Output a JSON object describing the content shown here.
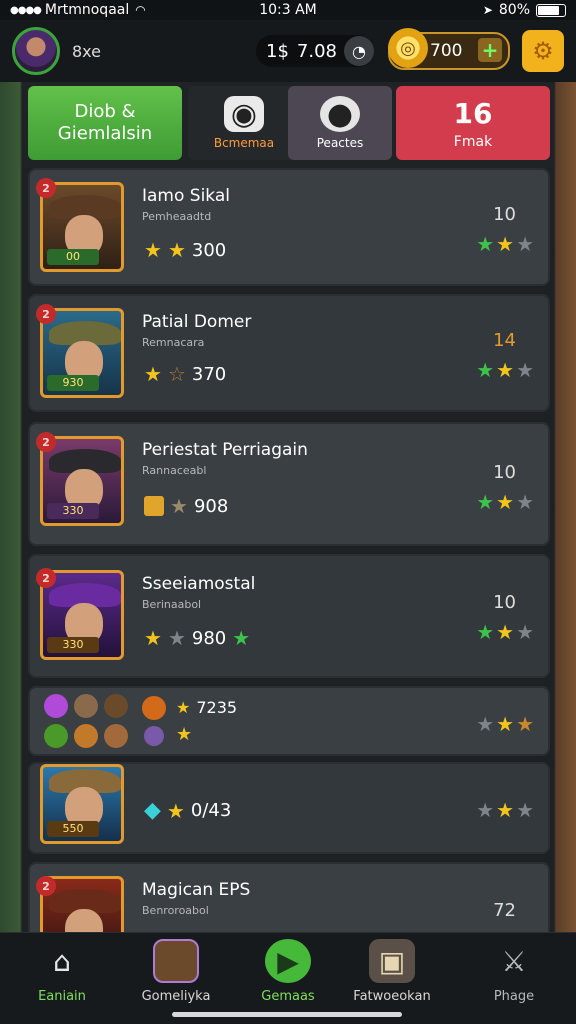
{
  "status_bar": {
    "carrier": "Mrtmnoqaal",
    "time": "10:3 AM",
    "battery": "80%"
  },
  "header": {
    "username": "8xe",
    "timer_value": "7.08",
    "timer_prefix": "1$",
    "coins": "700",
    "colors": {
      "accent_gold": "#f2b21c",
      "green": "#4fae40",
      "red": "#d33c4c"
    }
  },
  "tabs": [
    {
      "label": "Diob &\nGiemlalsin",
      "active": true
    },
    {
      "label": "Bcmemaa",
      "icon": "robot-icon"
    },
    {
      "label": "Peactes",
      "icon": "dog-icon"
    },
    {
      "value": "16",
      "label": "Fmak"
    }
  ],
  "cards": [
    {
      "badge": "2",
      "name": "Iamo Sikal",
      "subtitle": "Pemheaadtd",
      "score": "300",
      "level": "00",
      "rank": "10"
    },
    {
      "badge": "2",
      "name": "Patial Domer",
      "subtitle": "Remnacara",
      "score": "370",
      "level": "930",
      "rank": "14"
    },
    {
      "badge": "2",
      "name": "Periestat Perriagain",
      "subtitle": "Rannaceabl",
      "score": "908",
      "level": "330",
      "rank": "10"
    },
    {
      "badge": "2",
      "name": "Sseeiamostal",
      "subtitle": "Berinaabol",
      "score": "980",
      "level": "330",
      "rank": "10"
    },
    {
      "score": "7235"
    },
    {
      "score": "0/43",
      "level": "550"
    },
    {
      "badge": "2",
      "name": "Magican EPS",
      "subtitle": "Benroroabol",
      "rank": "72"
    }
  ],
  "nav": [
    {
      "label": "Eaniain",
      "icon": "home-icon"
    },
    {
      "label": "Gomeliyka",
      "icon": "hero-icon"
    },
    {
      "label": "Gemaas",
      "icon": "play-icon"
    },
    {
      "label": "Fatwoeokan",
      "icon": "chest-icon"
    },
    {
      "label": "Phage",
      "icon": "sword-icon"
    }
  ]
}
